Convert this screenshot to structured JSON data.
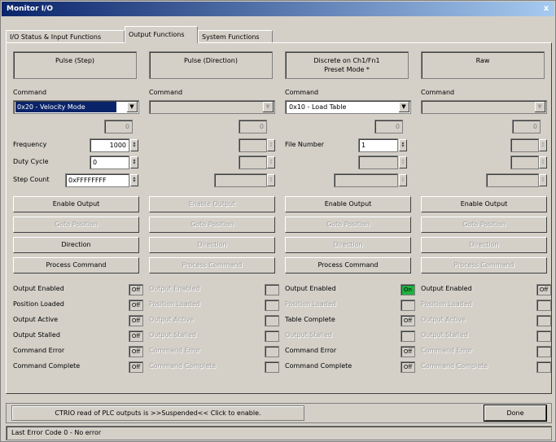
{
  "window": {
    "title": "Monitor I/O",
    "close_label": "x"
  },
  "tabs": [
    {
      "label": "I/O Status & Input Functions"
    },
    {
      "label": "Output Functions"
    },
    {
      "label": "System Functions"
    }
  ],
  "labels": {
    "command": "Command",
    "frequency": "Frequency",
    "duty_cycle": "Duty Cycle",
    "step_count": "Step Count",
    "file_number": "File Number",
    "enable_output": "Enable Output",
    "goto_position": "Goto Position",
    "direction": "Direction",
    "process_command": "Process Command",
    "output_enabled": "Output Enabled",
    "position_loaded": "Position Loaded",
    "output_active": "Output Active",
    "output_stalled": "Output Stalled",
    "command_error": "Command Error",
    "command_complete": "Command Complete",
    "table_complete": "Table Complete"
  },
  "columns": [
    {
      "header": "Pulse (Step)",
      "command": "0x20 - Velocity Mode",
      "readout": "0",
      "frequency": "1000",
      "duty_cycle": "0",
      "step_count": "0xFFFFFFFF",
      "status": [
        "Off",
        "Off",
        "Off",
        "Off",
        "Off",
        "Off"
      ]
    },
    {
      "header": "Pulse (Direction)",
      "readout": "0"
    },
    {
      "header": "Discrete on Ch1/Fn1\nPreset Mode *",
      "command": "0x10 - Load Table",
      "readout": "0",
      "file_number": "1",
      "status": {
        "output_enabled": "On",
        "table_complete": "Off",
        "command_error": "Off",
        "command_complete": "Off"
      }
    },
    {
      "header": "Raw",
      "readout": "0",
      "status": {
        "output_enabled": "Off"
      }
    }
  ],
  "colors": {
    "on": "#20b040",
    "title_start": "#0a246a",
    "title_end": "#a6caf0"
  },
  "footer": {
    "suspend_text": "CTRIO read of PLC outputs is >>Suspended<< Click to enable.",
    "done_label": "Done",
    "error_text": "Last Error Code  0 - No error"
  }
}
